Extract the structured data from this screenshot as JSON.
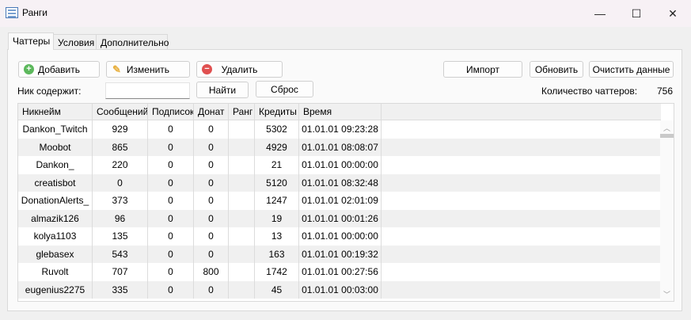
{
  "window": {
    "title": "Ранги",
    "minimize": "—",
    "maximize": "☐",
    "close": "✕"
  },
  "tabs": [
    {
      "label": "Чаттеры"
    },
    {
      "label": "Условия"
    },
    {
      "label": "Дополнительно"
    }
  ],
  "toolbar": {
    "add": "Добавить",
    "edit": "Изменить",
    "delete": "Удалить",
    "import": "Импорт",
    "refresh": "Обновить",
    "clear": "Очистить данные",
    "find": "Найти",
    "reset": "Сброс"
  },
  "search": {
    "label": "Ник содержит:",
    "value": ""
  },
  "count": {
    "label": "Количество чаттеров:",
    "value": "756"
  },
  "table": {
    "columns": [
      "Никнейм",
      "Сообщений",
      "Подписок",
      "Донат",
      "Ранг",
      "Кредиты",
      "Время"
    ],
    "rows": [
      [
        "Dankon_Twitch",
        "929",
        "0",
        "0",
        "",
        "5302",
        "01.01.01 09:23:28"
      ],
      [
        "Moobot",
        "865",
        "0",
        "0",
        "",
        "4929",
        "01.01.01 08:08:07"
      ],
      [
        "Dankon_",
        "220",
        "0",
        "0",
        "",
        "21",
        "01.01.01 00:00:00"
      ],
      [
        "creatisbot",
        "0",
        "0",
        "0",
        "",
        "5120",
        "01.01.01 08:32:48"
      ],
      [
        "DonationAlerts_",
        "373",
        "0",
        "0",
        "",
        "1247",
        "01.01.01 02:01:09"
      ],
      [
        "almazik126",
        "96",
        "0",
        "0",
        "",
        "19",
        "01.01.01 00:01:26"
      ],
      [
        "kolya1103",
        "135",
        "0",
        "0",
        "",
        "13",
        "01.01.01 00:00:00"
      ],
      [
        "glebasex",
        "543",
        "0",
        "0",
        "",
        "163",
        "01.01.01 00:19:32"
      ],
      [
        "Ruvolt",
        "707",
        "0",
        "800",
        "",
        "1742",
        "01.01.01 00:27:56"
      ],
      [
        "eugenius2275",
        "335",
        "0",
        "0",
        "",
        "45",
        "01.01.01 00:03:00"
      ]
    ]
  },
  "icons": {
    "add": "plus-circle-icon",
    "edit": "pencil-icon",
    "delete": "minus-circle-icon"
  },
  "colors": {
    "add": "#5cb85c",
    "delete": "#e05050",
    "edit": "#e8b040"
  }
}
